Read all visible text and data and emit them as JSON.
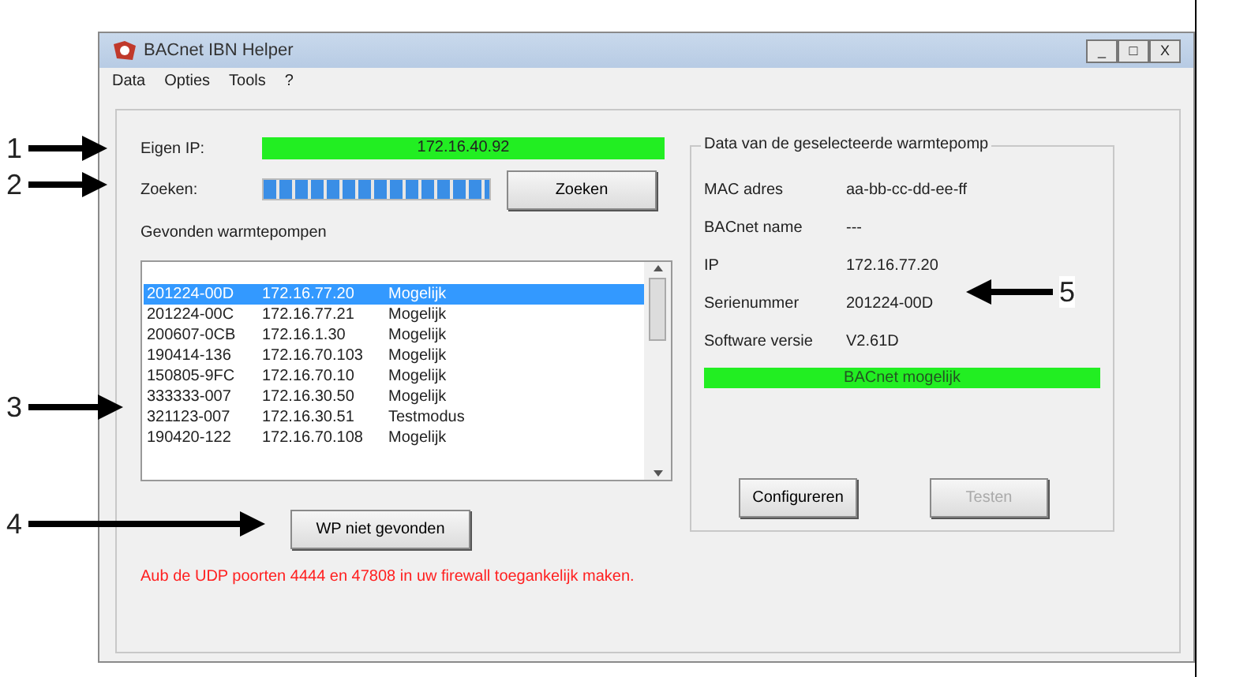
{
  "window": {
    "title": "BACnet IBN Helper",
    "controls": [
      "_",
      "□",
      "X"
    ]
  },
  "menu": [
    "Data",
    "Opties",
    "Tools",
    "?"
  ],
  "own_ip": {
    "label": "Eigen IP:",
    "value": "172.16.40.92"
  },
  "search": {
    "label": "Zoeken:",
    "level": 1,
    "button": "Zoeken"
  },
  "list": {
    "title": "Gevonden warmtepompen",
    "rows": [
      {
        "cells": [
          "201224-00D",
          "172.16.77.20",
          "Mogelijk"
        ],
        "selected": true
      },
      {
        "cells": [
          "201224-00C",
          "172.16.77.21",
          "Mogelijk"
        ],
        "selected": false
      },
      {
        "cells": [
          "200607-0CB",
          "172.16.1.30",
          "Mogelijk"
        ],
        "selected": false
      },
      {
        "cells": [
          "190414-136",
          "172.16.70.103",
          "Mogelijk"
        ],
        "selected": false
      },
      {
        "cells": [
          "150805-9FC",
          "172.16.70.10",
          "Mogelijk"
        ],
        "selected": false
      },
      {
        "cells": [
          "333333-007",
          "172.16.30.50",
          "Mogelijk"
        ],
        "selected": false
      },
      {
        "cells": [
          "321123-007",
          "172.16.30.51",
          "Testmodus"
        ],
        "selected": false
      },
      {
        "cells": [
          "190420-122",
          "172.16.70.108",
          "Mogelijk"
        ],
        "selected": false
      }
    ]
  },
  "not_found_button": "WP niet gevonden",
  "warning": "Aub de UDP poorten 4444 en 47808 in uw firewall toegankelijk maken.",
  "details": {
    "title": "Data van de geselecteerde warmtepomp",
    "fields": [
      {
        "label": "MAC adres",
        "value": "aa-bb-cc-dd-ee-ff"
      },
      {
        "label": "BACnet name",
        "value": "---"
      },
      {
        "label": "IP",
        "value": "172.16.77.20"
      },
      {
        "label": "Serienummer",
        "value": "201224-00D"
      },
      {
        "label": "Software versie",
        "value": "V2.61D"
      }
    ],
    "status": "BACnet mogelijk",
    "buttons": [
      {
        "label": "Configureren",
        "disabled": false
      },
      {
        "label": "Testen",
        "disabled": true
      }
    ]
  },
  "callouts": [
    "1",
    "2",
    "3",
    "4",
    "5"
  ]
}
